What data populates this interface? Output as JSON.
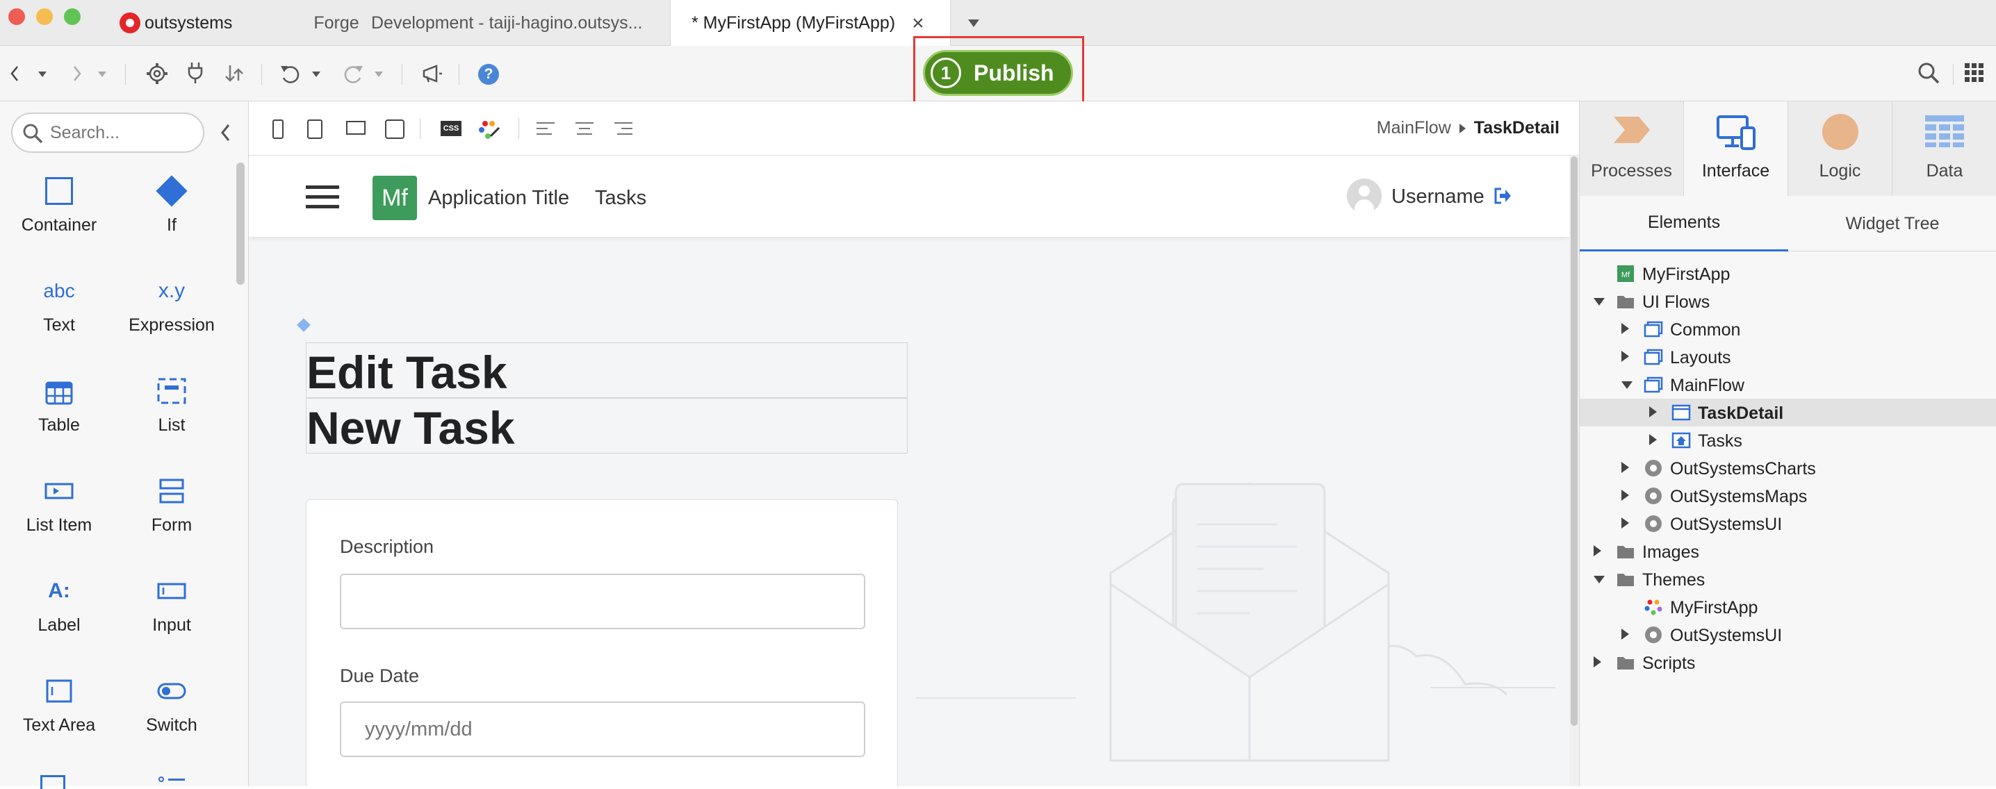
{
  "window": {
    "brand": "outsystems",
    "tabs": [
      {
        "label": "Forge"
      },
      {
        "label": "Development - taiji-hagino.outsys..."
      },
      {
        "label": "* MyFirstApp (MyFirstApp)"
      }
    ]
  },
  "toolbar": {
    "publish_step": "1",
    "publish_label": "Publish"
  },
  "toolbox": {
    "search_placeholder": "Search...",
    "widgets": [
      {
        "label": "Container",
        "icon": "container-icon"
      },
      {
        "label": "If",
        "icon": "diamond-icon"
      },
      {
        "label": "Text",
        "icon_text": "abc"
      },
      {
        "label": "Expression",
        "icon_text": "x.y"
      },
      {
        "label": "Table",
        "icon": "table-icon"
      },
      {
        "label": "List",
        "icon": "list-icon"
      },
      {
        "label": "List Item",
        "icon": "list-item-icon"
      },
      {
        "label": "Form",
        "icon": "form-icon"
      },
      {
        "label": "Label",
        "icon_text": "A:"
      },
      {
        "label": "Input",
        "icon": "input-icon"
      },
      {
        "label": "Text Area",
        "icon": "text-area-icon"
      },
      {
        "label": "Switch",
        "icon": "switch-icon"
      }
    ]
  },
  "breadcrumb": {
    "flow": "MainFlow",
    "screen": "TaskDetail"
  },
  "canvas": {
    "app_logo": "Mf",
    "app_title": "Application Title",
    "menu_link": "Tasks",
    "username": "Username",
    "title_edit": "Edit Task",
    "title_new": "New Task",
    "form": {
      "description_label": "Description",
      "description_value": "",
      "due_date_label": "Due Date",
      "due_date_placeholder": "yyyy/mm/dd"
    }
  },
  "right_panel": {
    "tabs": [
      {
        "label": "Processes"
      },
      {
        "label": "Interface"
      },
      {
        "label": "Logic"
      },
      {
        "label": "Data"
      }
    ],
    "subtabs": [
      {
        "label": "Elements"
      },
      {
        "label": "Widget Tree"
      }
    ],
    "tree": [
      {
        "label": "MyFirstApp",
        "icon": "app-icon",
        "level": 0,
        "arrow": "none"
      },
      {
        "label": "UI Flows",
        "icon": "folder-icon",
        "level": 0,
        "arrow": "down"
      },
      {
        "label": "Common",
        "icon": "flow-icon",
        "level": 1,
        "arrow": "right"
      },
      {
        "label": "Layouts",
        "icon": "flow-icon",
        "level": 1,
        "arrow": "right"
      },
      {
        "label": "MainFlow",
        "icon": "flow-icon",
        "level": 1,
        "arrow": "down"
      },
      {
        "label": "TaskDetail",
        "icon": "screen-icon",
        "level": 2,
        "arrow": "right",
        "selected": true
      },
      {
        "label": "Tasks",
        "icon": "home-screen-icon",
        "level": 2,
        "arrow": "right"
      },
      {
        "label": "OutSystemsCharts",
        "icon": "module-icon",
        "level": 1,
        "arrow": "right"
      },
      {
        "label": "OutSystemsMaps",
        "icon": "module-icon",
        "level": 1,
        "arrow": "right"
      },
      {
        "label": "OutSystemsUI",
        "icon": "module-icon",
        "level": 1,
        "arrow": "right"
      },
      {
        "label": "Images",
        "icon": "folder-icon",
        "level": 0,
        "arrow": "right"
      },
      {
        "label": "Themes",
        "icon": "folder-icon",
        "level": 0,
        "arrow": "down"
      },
      {
        "label": "MyFirstApp",
        "icon": "theme-icon",
        "level": 1,
        "arrow": "none"
      },
      {
        "label": "OutSystemsUI",
        "icon": "module-icon",
        "level": 1,
        "arrow": "right"
      },
      {
        "label": "Scripts",
        "icon": "folder-icon",
        "level": 0,
        "arrow": "right"
      }
    ]
  },
  "colors": {
    "publish_green": "#4f8c1f",
    "highlight_red": "#e53935",
    "accent_blue": "#2f6fd6",
    "app_logo_green": "#3d9b5b"
  }
}
